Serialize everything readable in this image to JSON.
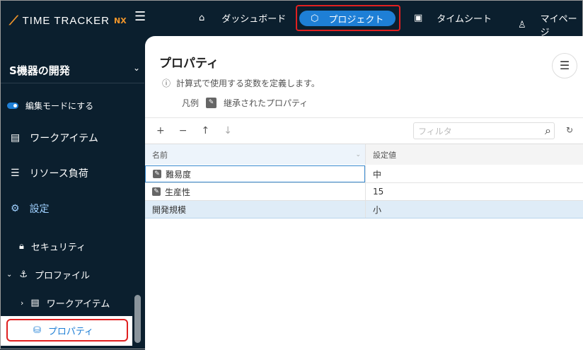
{
  "brand": {
    "name": "TIME TRACKER",
    "suffix": "NX"
  },
  "topnav": {
    "dashboard": "ダッシュボード",
    "project": "プロジェクト",
    "timesheet": "タイムシート",
    "mypage": "マイページ"
  },
  "sidebar": {
    "project_name": "S機器の開発",
    "edit_mode": "編集モードにする",
    "items": [
      "ワークアイテム",
      "リソース負荷",
      "設定"
    ],
    "sub": {
      "security": "セキュリティ",
      "profile": "プロファイル",
      "workitem": "ワークアイテム",
      "property": "プロパティ"
    }
  },
  "main": {
    "title": "プロパティ",
    "description": "計算式で使用する変数を定義します。",
    "legend_label": "凡例",
    "legend_item": "継承されたプロパティ",
    "filter_placeholder": "フィルタ",
    "columns": [
      "名前",
      "設定値"
    ],
    "rows": [
      {
        "name": "難易度",
        "value": "中",
        "inherited": true
      },
      {
        "name": "生産性",
        "value": "15",
        "inherited": true
      },
      {
        "name": "開発規模",
        "value": "小",
        "inherited": false
      }
    ]
  },
  "colors": {
    "accent": "#1e7fd6",
    "brand_orange": "#f0952b",
    "highlight": "#e02020"
  }
}
